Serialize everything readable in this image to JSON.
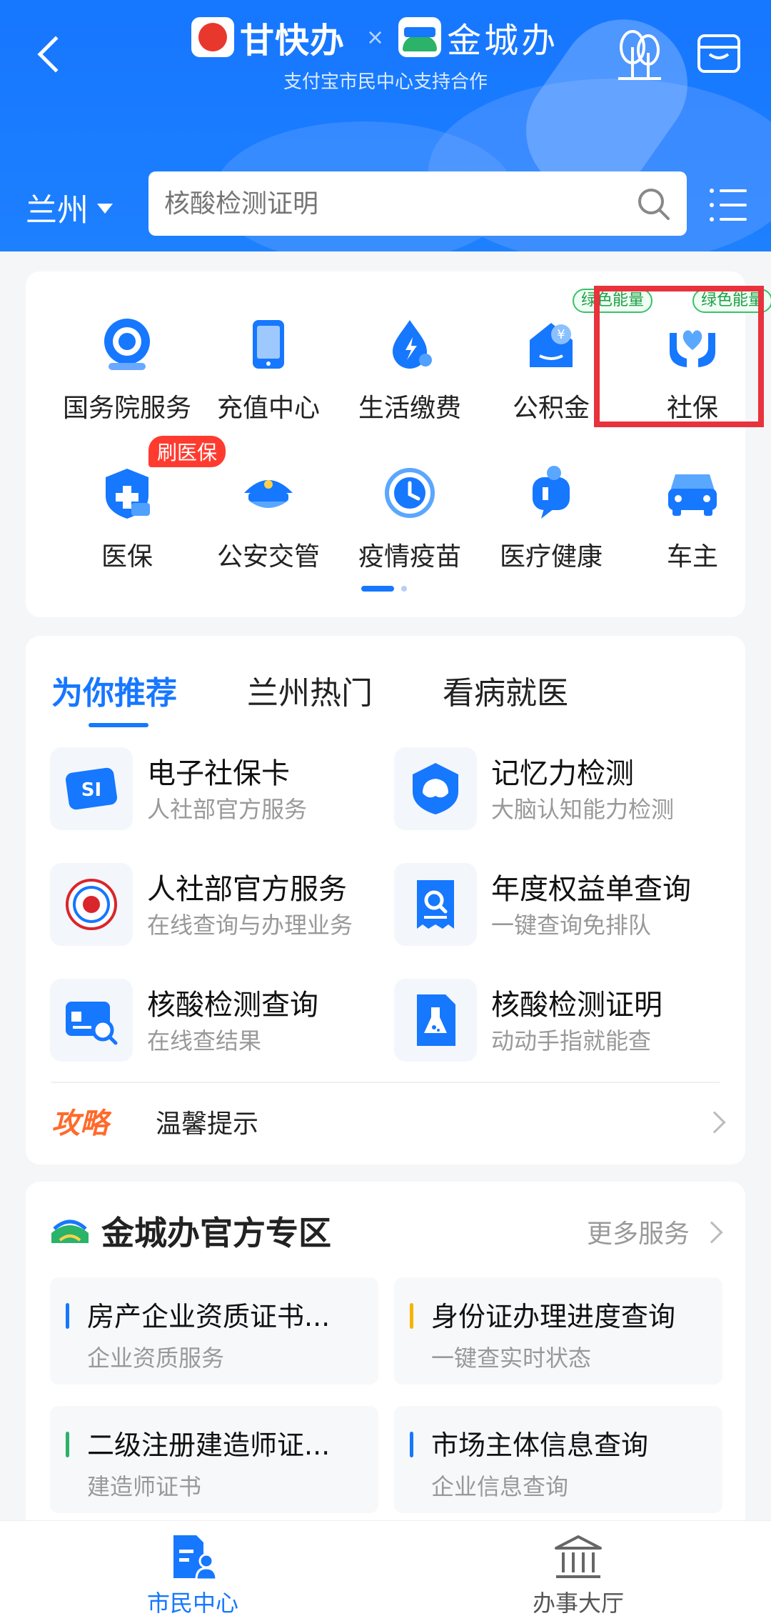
{
  "header": {
    "brand_a": "甘快办",
    "separator": "×",
    "brand_b": "金城办",
    "subtitle": "支付宝市民中心支持合作",
    "city": "兰州",
    "search_placeholder": "核酸检测证明"
  },
  "colors": {
    "primary": "#1677ff",
    "highlight": "#e8323c",
    "green_badge": "#38c267",
    "red_badge": "#ff3b30",
    "tips_orange": "#ff6a2c"
  },
  "services": [
    {
      "label": "国务院服务",
      "icon": "state-council-icon"
    },
    {
      "label": "充值中心",
      "icon": "phone-recharge-icon"
    },
    {
      "label": "生活缴费",
      "icon": "utility-payment-icon"
    },
    {
      "label": "公积金",
      "icon": "housing-fund-icon",
      "badge": "绿色能量"
    },
    {
      "label": "社保",
      "icon": "social-security-icon",
      "badge": "绿色能量"
    },
    {
      "label": "医保",
      "icon": "medical-insurance-icon",
      "badge": "刷医保"
    },
    {
      "label": "公安交管",
      "icon": "police-cap-icon"
    },
    {
      "label": "疫情疫苗",
      "icon": "vaccine-clock-icon"
    },
    {
      "label": "医疗健康",
      "icon": "health-chat-icon"
    },
    {
      "label": "车主",
      "icon": "car-icon"
    }
  ],
  "tabs": [
    "为你推荐",
    "兰州热门",
    "看病就医"
  ],
  "recommendations": [
    {
      "title": "电子社保卡",
      "subtitle": "人社部官方服务"
    },
    {
      "title": "记忆力检测",
      "subtitle": "大脑认知能力检测"
    },
    {
      "title": "人社部官方服务",
      "subtitle": "在线查询与办理业务"
    },
    {
      "title": "年度权益单查询",
      "subtitle": "一键查询免排队"
    },
    {
      "title": "核酸检测查询",
      "subtitle": "在线查结果"
    },
    {
      "title": "核酸检测证明",
      "subtitle": "动动手指就能查"
    }
  ],
  "tips": {
    "tag": "攻略",
    "text": "温馨提示"
  },
  "zone": {
    "title": "金城办官方专区",
    "more": "更多服务",
    "items": [
      {
        "title": "房产企业资质证书...",
        "subtitle": "企业资质服务",
        "bar_color": "#1677ff"
      },
      {
        "title": "身份证办理进度查询",
        "subtitle": "一键查实时状态",
        "bar_color": "#f5b400"
      },
      {
        "title": "二级注册建造师证...",
        "subtitle": "建造师证书",
        "bar_color": "#2bb36a"
      },
      {
        "title": "市场主体信息查询",
        "subtitle": "企业信息查询",
        "bar_color": "#1677ff"
      }
    ]
  },
  "bottom_nav": [
    {
      "label": "市民中心",
      "active": true
    },
    {
      "label": "办事大厅",
      "active": false
    }
  ]
}
